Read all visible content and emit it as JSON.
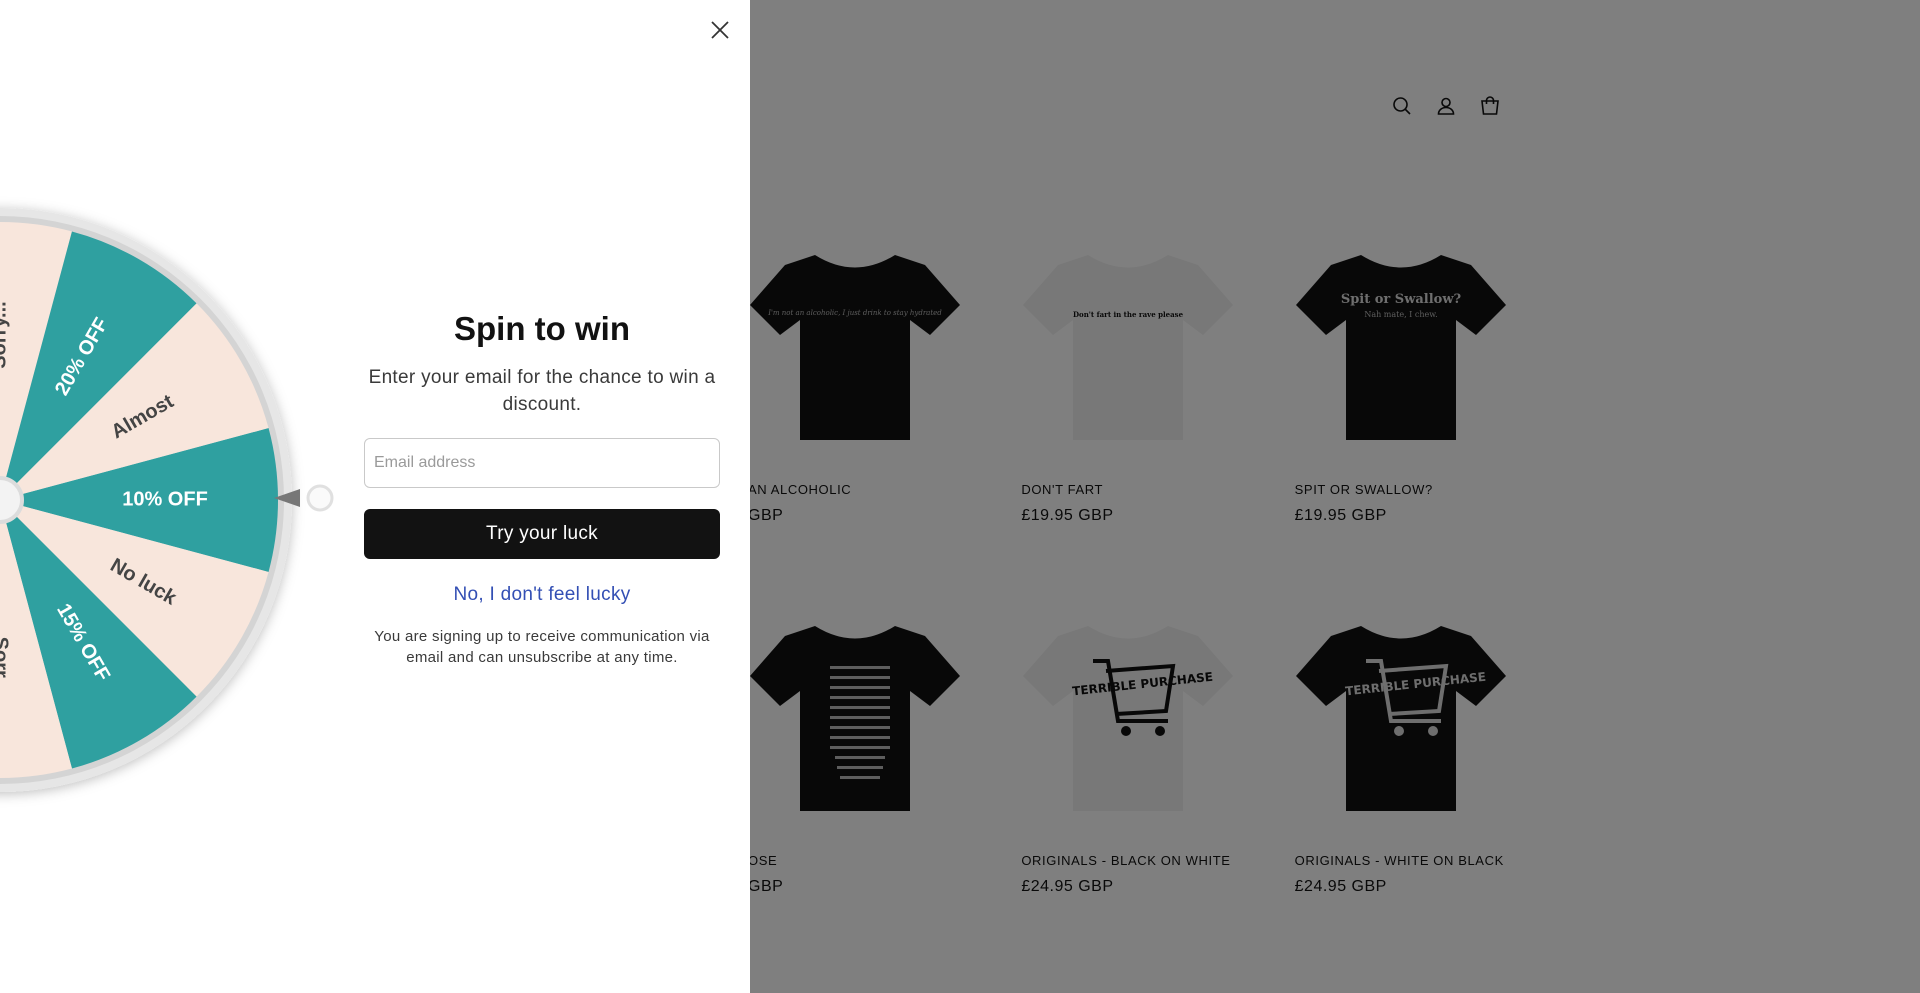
{
  "store": {
    "products": [
      {
        "title": "I'M NOT AN ALCOHOLIC",
        "visible_title": "AN ALCOHOLIC",
        "price": "GBP",
        "shirt": "black",
        "print": "I'm not an alcoholic, I just drink to stay hydrated"
      },
      {
        "title": "DON'T FART",
        "visible_title": "DON'T FART",
        "price": "£19.95 GBP",
        "shirt": "white",
        "print": "Don't fart in the rave please"
      },
      {
        "title": "SPIT OR SWALLOW?",
        "visible_title": "SPIT OR SWALLOW?",
        "price": "£19.95 GBP",
        "shirt": "black",
        "print": "Spit or Swallow?",
        "print2": "Nah mate, I chew."
      },
      {
        "title": "SILLY GOOSE",
        "visible_title": "OSE",
        "price": "GBP",
        "shirt": "black",
        "print": "silly goose languages"
      },
      {
        "title": "ORIGINALS - BLACK ON WHITE",
        "visible_title": "ORIGINALS - BLACK ON WHITE",
        "price": "£24.95 GBP",
        "shirt": "white",
        "print": "TERRIBLE PURCHASE"
      },
      {
        "title": "ORIGINALS - WHITE ON BLACK",
        "visible_title": "ORIGINALS - WHITE ON BLACK",
        "price": "£24.95 GBP",
        "shirt": "black",
        "print": "TERRIBLE PURCHASE"
      }
    ],
    "header_icons": [
      "search-icon",
      "account-icon",
      "cart-icon"
    ]
  },
  "modal": {
    "title": "Spin to win",
    "subtitle": "Enter your email for the chance to win a discount.",
    "email_placeholder": "Email address",
    "submit_label": "Try your luck",
    "decline_label": "No, I don't feel lucky",
    "disclaimer": "You are signing up to receive communication via email and can unsubscribe at any time.",
    "wheel": {
      "segments": [
        "Sorry...",
        "20% OFF",
        "Almost",
        "10% OFF",
        "No luck",
        "15% OFF",
        "Sorr..."
      ],
      "colors": {
        "teal": "#2fa0a0",
        "cream": "#f8e6dc",
        "rim": "#e3e3e3"
      }
    }
  },
  "colors": {
    "button": "#121212",
    "link": "#334fb4",
    "overlay": "rgba(0,0,0,0.5)"
  }
}
